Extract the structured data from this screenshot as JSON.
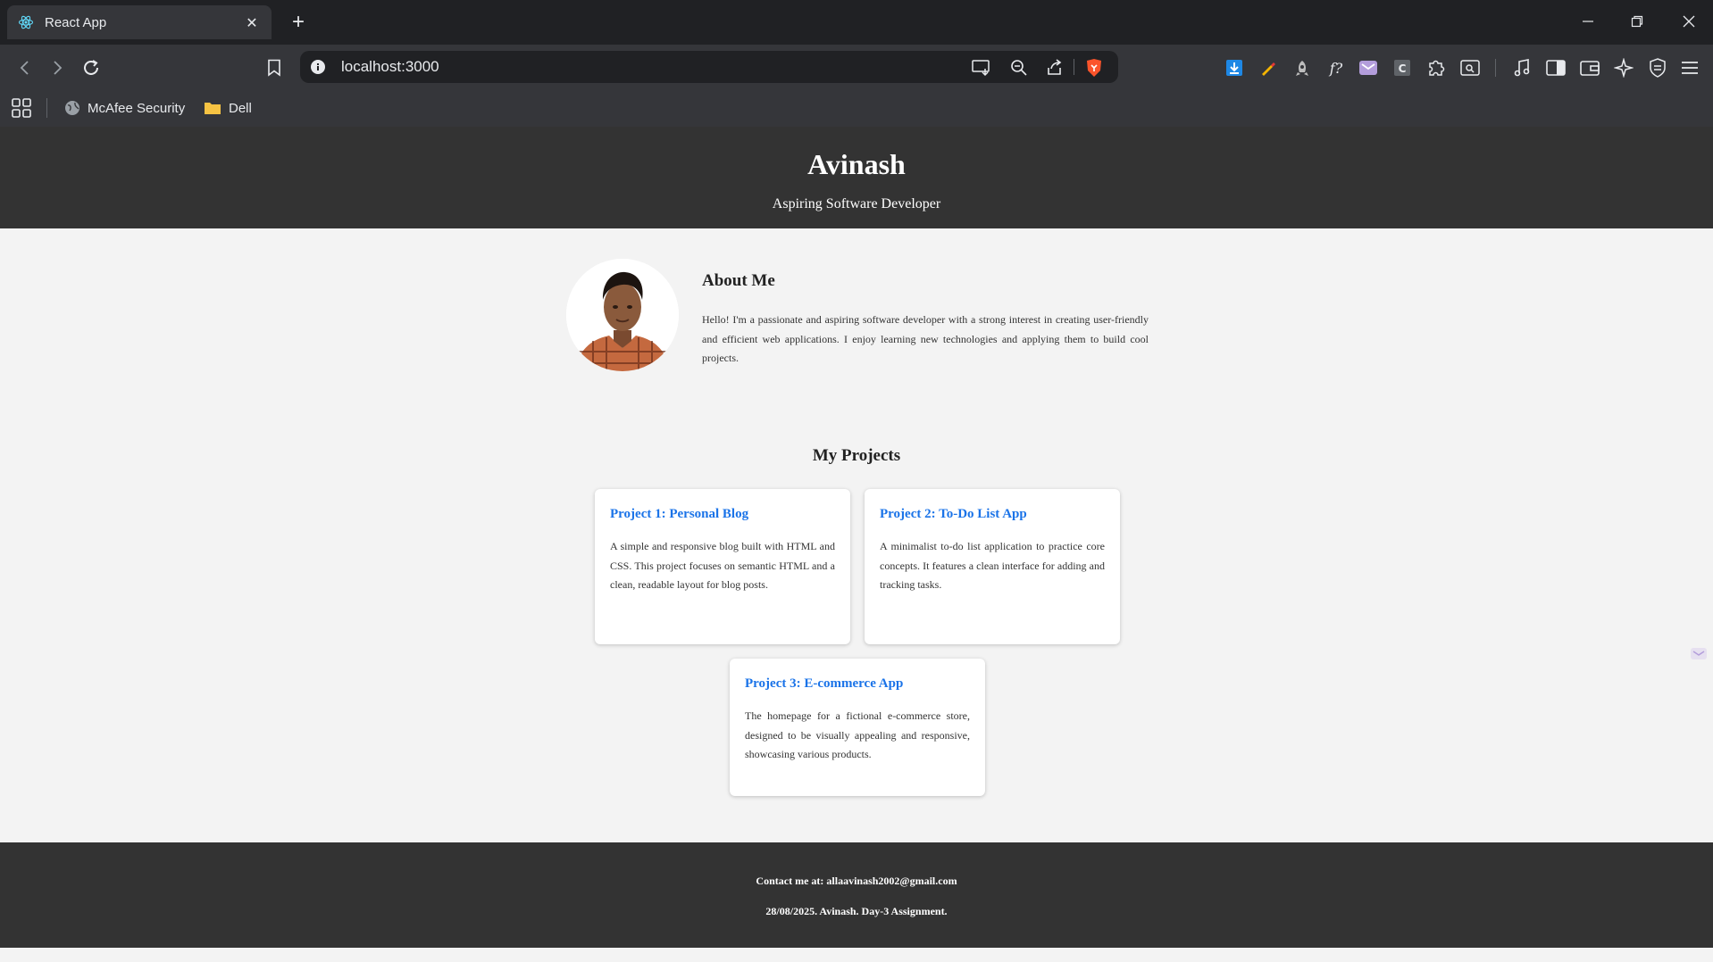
{
  "browser": {
    "tab_title": "React App",
    "url": "localhost:3000",
    "bookmarks": [
      "McAfee Security",
      "Dell"
    ]
  },
  "header": {
    "name": "Avinash",
    "tagline": "Aspiring Software Developer"
  },
  "about": {
    "title": "About Me",
    "text": "Hello! I'm a passionate and aspiring software developer with a strong interest in creating user-friendly and efficient web applications. I enjoy learning new technologies and applying them to build cool projects."
  },
  "projects": {
    "title": "My Projects",
    "items": [
      {
        "title": "Project 1: Personal Blog",
        "text": "A simple and responsive blog built with HTML and CSS. This project focuses on semantic HTML and a clean, readable layout for blog posts."
      },
      {
        "title": "Project 2: To-Do List App",
        "text": "A minimalist to-do list application to practice core concepts. It features a clean interface for adding and tracking tasks."
      },
      {
        "title": "Project 3: E-commerce App",
        "text": "The homepage for a fictional e-commerce store, designed to be visually appealing and responsive, showcasing various products."
      }
    ]
  },
  "footer": {
    "contact": "Contact me at: allaavinash2002@gmail.com",
    "note": "28/08/2025. Avinash. Day-3 Assignment."
  },
  "colors": {
    "header_bg": "#333333",
    "page_bg": "#f3f3f3",
    "project_title": "#1a73e8"
  }
}
